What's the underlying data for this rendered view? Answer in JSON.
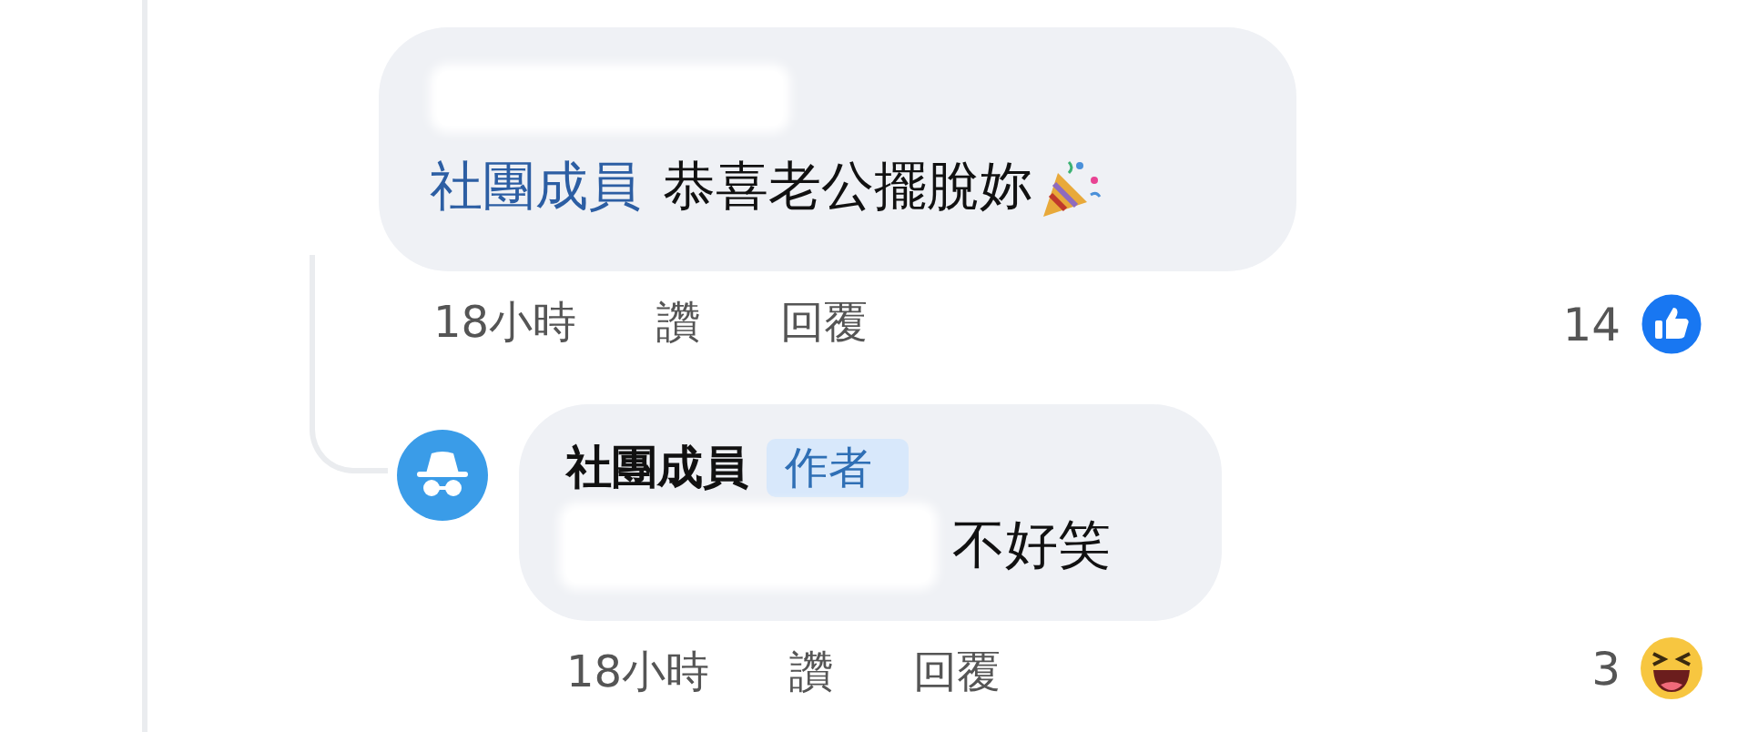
{
  "comments": [
    {
      "kind": "comment",
      "mention": "社團成員",
      "text": "恭喜老公擺脫妳",
      "emoji": true,
      "redacted_name": true,
      "time": "18小時",
      "like_label": "讚",
      "reply_label": "回覆",
      "reaction": {
        "kind": "like",
        "count": "14"
      }
    },
    {
      "kind": "reply",
      "name": "社團成員",
      "badge": "作者",
      "redacted_prefix": true,
      "text": "不好笑",
      "time": "18小時",
      "like_label": "讚",
      "reply_label": "回覆",
      "reaction": {
        "kind": "haha",
        "count": "3"
      }
    }
  ]
}
